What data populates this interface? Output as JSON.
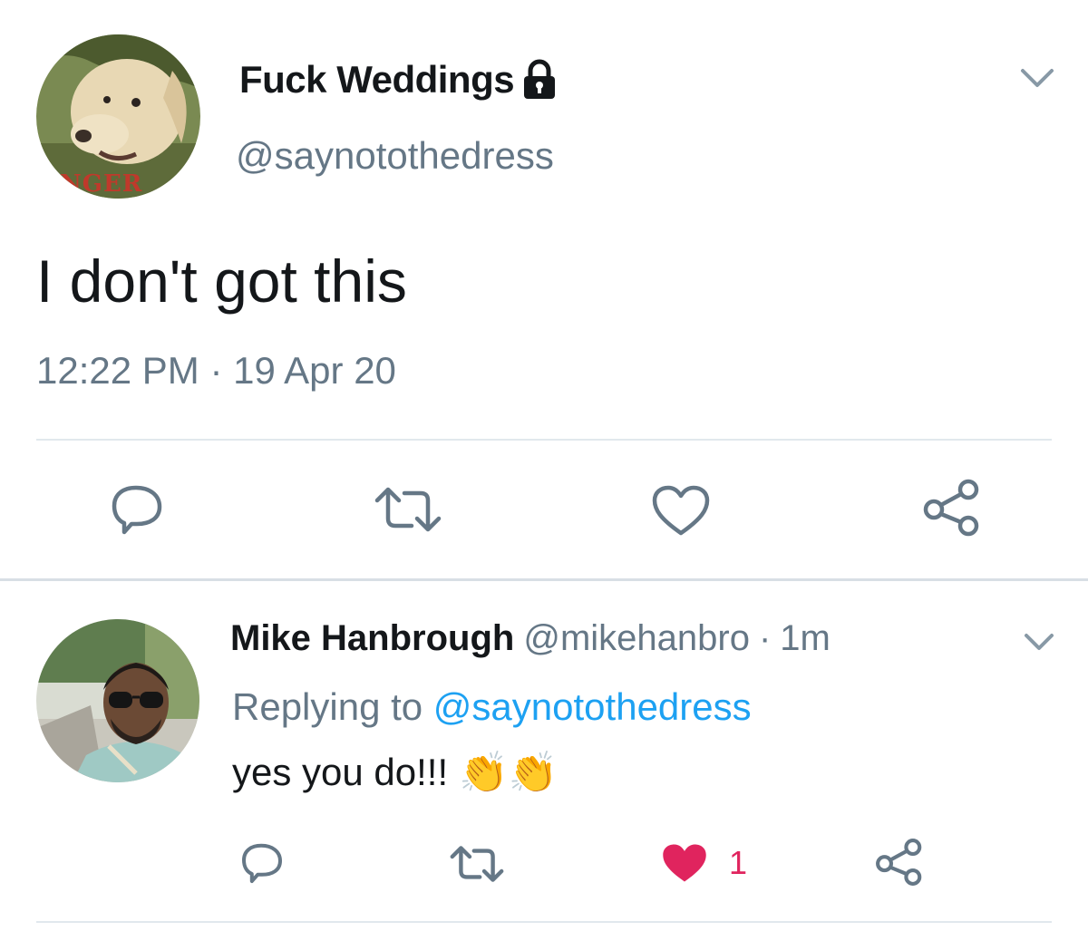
{
  "main_tweet": {
    "display_name": "Fuck Weddings",
    "handle": "@saynotothedress",
    "avatar_caption": "NGER",
    "text": "I don't got this",
    "timestamp": "12:22 PM · 19 Apr 20",
    "icons": {
      "locked": "lock-icon",
      "menu": "chevron-down-icon",
      "reply": "reply-icon",
      "retweet": "retweet-icon",
      "like": "heart-icon",
      "share": "share-icon"
    }
  },
  "reply_tweet": {
    "display_name": "Mike Hanbrough",
    "handle": "@mikehanbro",
    "separator": "·",
    "age": "1m",
    "replying_prefix": "Replying to",
    "replying_handle": "@saynotothedress",
    "text": "yes you do!!!",
    "emoji": "👏👏",
    "like_count": "1",
    "icons": {
      "menu": "chevron-down-icon",
      "reply": "reply-icon",
      "retweet": "retweet-icon",
      "like": "heart-filled-icon",
      "share": "share-icon"
    }
  },
  "colors": {
    "text": "#14171a",
    "muted": "#657786",
    "link": "#1da1f2",
    "like_active": "#e0245e",
    "divider": "#e1e8ed"
  }
}
